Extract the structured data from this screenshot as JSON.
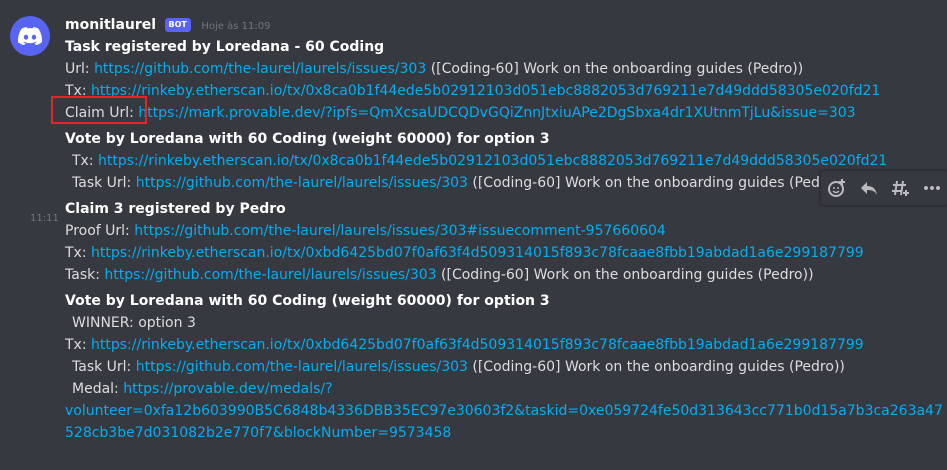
{
  "bot": {
    "name": "monitlaurel",
    "tag": "BOT",
    "timestamp": "Hoje às 11:09"
  },
  "side_time": "11:11",
  "message1": {
    "title": "Task registered by Loredana - 60 Coding",
    "url_label": "Url: ",
    "url": "https://github.com/the-laurel/laurels/issues/303",
    "url_suffix": " ([Coding-60] Work on the onboarding guides (Pedro))",
    "tx_label": "Tx: ",
    "tx": "https://rinkeby.etherscan.io/tx/0x8ca0b1f44ede5b02912103d051ebc8882053d769211e7d49ddd58305e020fd21",
    "claim_label": "Claim Url: ",
    "claim": "https://mark.provable.dev/?ipfs=QmXcsaUDCQDvGQiZnnJtxiuAPe2DgSbxa4dr1XUtnmTjLu&issue=303"
  },
  "message2": {
    "title": "Vote by Loredana with 60 Coding (weight 60000) for option 3",
    "tx_label": "Tx: ",
    "tx": "https://rinkeby.etherscan.io/tx/0x8ca0b1f44ede5b02912103d051ebc8882053d769211e7d49ddd58305e020fd21",
    "task_label": "Task Url: ",
    "task": "https://github.com/the-laurel/laurels/issues/303",
    "task_suffix": " ([Coding-60] Work on the onboarding guides (Pedro))"
  },
  "message3": {
    "title": "Claim 3 registered by Pedro",
    "proof_label": "Proof Url: ",
    "proof": "https://github.com/the-laurel/laurels/issues/303#issuecomment-957660604",
    "tx_label": "Tx: ",
    "tx": "https://rinkeby.etherscan.io/tx/0xbd6425bd07f0af63f4d509314015f893c78fcaae8fbb19abdad1a6e299187799",
    "task_label": "Task: ",
    "task": "https://github.com/the-laurel/laurels/issues/303",
    "task_suffix": " ([Coding-60] Work on the onboarding guides (Pedro))"
  },
  "message4": {
    "title": "Vote by Loredana with 60 Coding (weight 60000) for option 3",
    "winner": "WINNER: option 3",
    "tx_label": "Tx: ",
    "tx": "https://rinkeby.etherscan.io/tx/0xbd6425bd07f0af63f4d509314015f893c78fcaae8fbb19abdad1a6e299187799",
    "task_label": "Task Url: ",
    "task": "https://github.com/the-laurel/laurels/issues/303",
    "task_suffix": " ([Coding-60] Work on the onboarding guides (Pedro))",
    "medal_label": "Medal: ",
    "medal_part1": "https://provable.dev/medals/?",
    "medal_part2": "volunteer=0xfa12b603990B5C6848b4336DBB35EC97e30603f2&taskid=0xe059724fe50d313643cc771b0d15a7b3ca263a47",
    "medal_part3": "528cb3be7d031082b2e770f7&blockNumber=9573458"
  },
  "toolbar": {
    "icons": [
      "add-reaction-icon",
      "reply-icon",
      "create-thread-icon",
      "more-icon"
    ]
  },
  "colors": {
    "background": "#36393f",
    "link": "#00aff4",
    "blurple": "#5865f2",
    "highlight_box": "#e8242b"
  }
}
